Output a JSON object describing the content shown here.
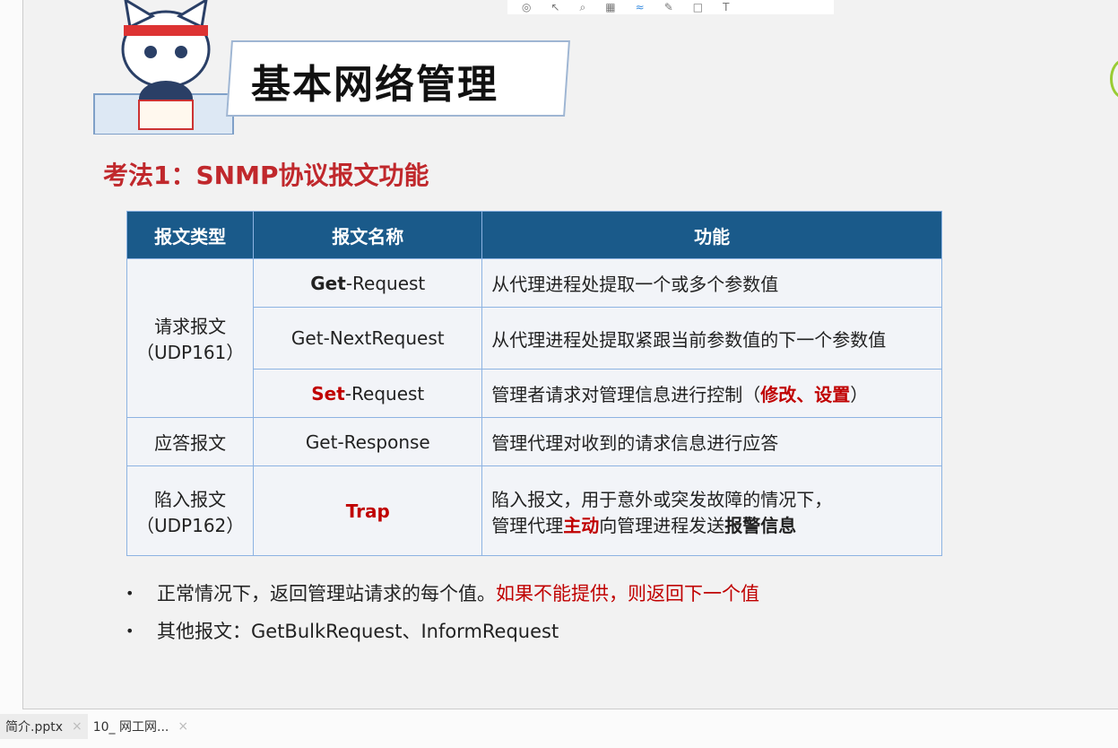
{
  "slide": {
    "title": "基本网络管理",
    "subtitle": "考法1：SNMP协议报文功能",
    "table": {
      "headers": [
        "报文类型",
        "报文名称",
        "功能"
      ],
      "groups": {
        "request": "请求报文\n（UDP161）",
        "response": "应答报文",
        "trap": "陷入报文\n（UDP162）"
      },
      "rows": [
        {
          "name_bold": "Get",
          "name_rest": "-Request",
          "function": "从代理进程处提取一个或多个参数值"
        },
        {
          "name_bold": "",
          "name_rest": "Get-NextRequest",
          "function": "从代理进程处提取紧跟当前参数值的下一个参数值"
        },
        {
          "name_bold": "Set",
          "name_rest": "-Request",
          "function": "管理者请求对管理信息进行控制（",
          "function_red": "修改、设置",
          "function_end": "）"
        },
        {
          "name_bold": "",
          "name_rest": "Get-Response",
          "function": "管理代理对收到的请求信息进行应答"
        },
        {
          "name_bold": "Trap",
          "name_rest": "",
          "function": "陷入报文，用于意外或突发故障的情况下，",
          "function2": "管理代理",
          "function_red": "主动",
          "function3": "向管理进程发送",
          "function_bold": "报警信息"
        }
      ]
    },
    "bullets": [
      {
        "text": "正常情况下，返回管理站请求的每个值。",
        "red": "如果不能提供，则返回下一个值"
      },
      {
        "text": "其他报文：GetBulkRequest、InformRequest"
      }
    ],
    "bullet_symbol": "•"
  },
  "toolbar": {
    "icons": [
      "target-icon",
      "pointer-icon",
      "magnifier-icon",
      "grid-icon",
      "pen-icon",
      "highlighter-icon",
      "shape-icon",
      "text-icon"
    ]
  },
  "tabs": [
    {
      "label": "简介.pptx",
      "close": "×"
    },
    {
      "label": "10_ 网工网...",
      "close": "×"
    }
  ],
  "colors": {
    "header": "#1a5a8a",
    "accent_red": "#c00000",
    "border": "#8db3e2"
  }
}
